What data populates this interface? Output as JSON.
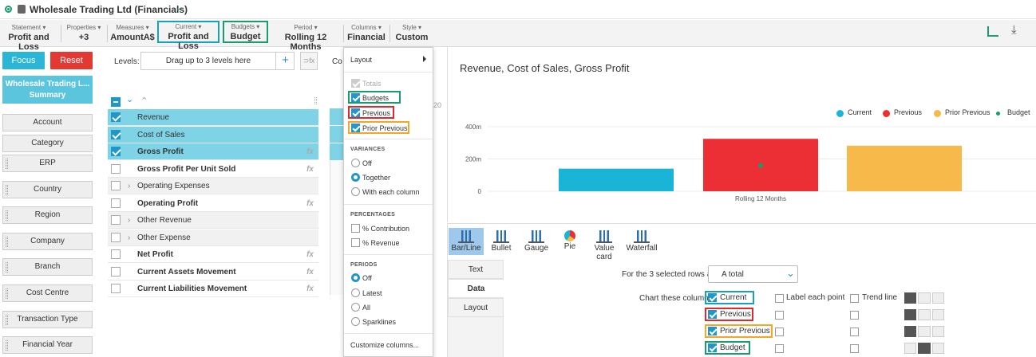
{
  "app": {
    "title": "Wholesale Trading Ltd (Financials)"
  },
  "toolbar": {
    "statement": {
      "label": "Statement ▾",
      "value": "Profit and Loss"
    },
    "properties": {
      "label": "Properties ▾",
      "value": "+3"
    },
    "measures": {
      "label": "Measures ▾",
      "value": "AmountA$"
    },
    "current": {
      "label": "Current ▾",
      "value": "Profit and Loss"
    },
    "budgets": {
      "label": "Budgets ▾",
      "value": "Budget"
    },
    "period": {
      "label": "Period ▾",
      "value": "Rolling 12 Months"
    },
    "columns": {
      "label": "Columns ▾",
      "value": "Financial"
    },
    "style": {
      "label": "Style ▾",
      "value": "Custom"
    }
  },
  "left": {
    "focus": "Focus",
    "reset": "Reset",
    "summary_line1": "Wholesale Trading L...",
    "summary_line2": "Summary",
    "dimensions": [
      "Account",
      "Category",
      "ERP",
      "Country",
      "Region",
      "Company",
      "Branch",
      "Cost Centre",
      "Transaction Type",
      "Financial Year"
    ]
  },
  "levels": {
    "label": "Levels:",
    "placeholder": "Drag up to 3 levels here",
    "plus": "+",
    "fx": "⊃fx",
    "col_prefix": "Co"
  },
  "rows": [
    {
      "label": "Revenue",
      "bold": false,
      "checked": true,
      "expand": false,
      "fx": false
    },
    {
      "label": "Cost of Sales",
      "bold": false,
      "checked": true,
      "expand": false,
      "fx": false
    },
    {
      "label": "Gross Profit",
      "bold": true,
      "checked": true,
      "expand": false,
      "fx": true
    },
    {
      "label": "Gross Profit Per Unit Sold",
      "bold": true,
      "checked": false,
      "expand": false,
      "fx": true
    },
    {
      "label": "Operating Expenses",
      "bold": false,
      "checked": false,
      "expand": true,
      "fx": false
    },
    {
      "label": "Operating Profit",
      "bold": true,
      "checked": false,
      "expand": false,
      "fx": true
    },
    {
      "label": "Other Revenue",
      "bold": false,
      "checked": false,
      "expand": true,
      "fx": false
    },
    {
      "label": "Other Expense",
      "bold": false,
      "checked": false,
      "expand": true,
      "fx": false
    },
    {
      "label": "Net Profit",
      "bold": true,
      "checked": false,
      "expand": false,
      "fx": true
    },
    {
      "label": "Current Assets Movement",
      "bold": true,
      "checked": false,
      "expand": false,
      "fx": true
    },
    {
      "label": "Current Liabilities Movement",
      "bold": true,
      "checked": false,
      "expand": false,
      "fx": true
    }
  ],
  "fx_label": "fx",
  "menu": {
    "layout": "Layout",
    "totals": "Totals",
    "budgets": "Budgets",
    "previous": "Previous",
    "prior_previous": "Prior Previous",
    "variances_title": "VARIANCES",
    "variances": [
      "Off",
      "Together",
      "With each column"
    ],
    "percentages_title": "PERCENTAGES",
    "percentages": [
      "% Contribution",
      "% Revenue"
    ],
    "periods_title": "PERIODS",
    "periods": [
      "Off",
      "Latest",
      "All",
      "Sparklines"
    ],
    "customize": "Customize columns..."
  },
  "chart_data": {
    "type": "bar",
    "title": "Revenue, Cost of Sales, Gross Profit",
    "categories": [
      "Rolling 12 Months"
    ],
    "series": [
      {
        "name": "Current",
        "values": [
          140
        ],
        "color": "#1ab4d6"
      },
      {
        "name": "Previous",
        "values": [
          325
        ],
        "color": "#ec2f34"
      },
      {
        "name": "Prior Previous",
        "values": [
          282
        ],
        "color": "#f6b94a"
      },
      {
        "name": "Budget",
        "values": [
          140
        ],
        "color": "#1a9c6e",
        "marker": true
      }
    ],
    "yticks": [
      "400m",
      "200m",
      "0"
    ],
    "ylim": [
      0,
      400
    ],
    "unit": "m",
    "legend": "top-right"
  },
  "chart_types": [
    "Bar/Line",
    "Bullet",
    "Gauge",
    "Pie",
    "Value card",
    "Waterfall"
  ],
  "side_tabs": [
    "Text",
    "Data",
    "Layout"
  ],
  "options": {
    "rows_as_label": "For the 3 selected rows as:",
    "rows_as_value": "A total",
    "chart_cols_label": "Chart these columns:",
    "label_each_point": "Label each point",
    "trend_line": "Trend line",
    "columns": [
      "Current",
      "Previous",
      "Prior Previous",
      "Budget"
    ]
  }
}
